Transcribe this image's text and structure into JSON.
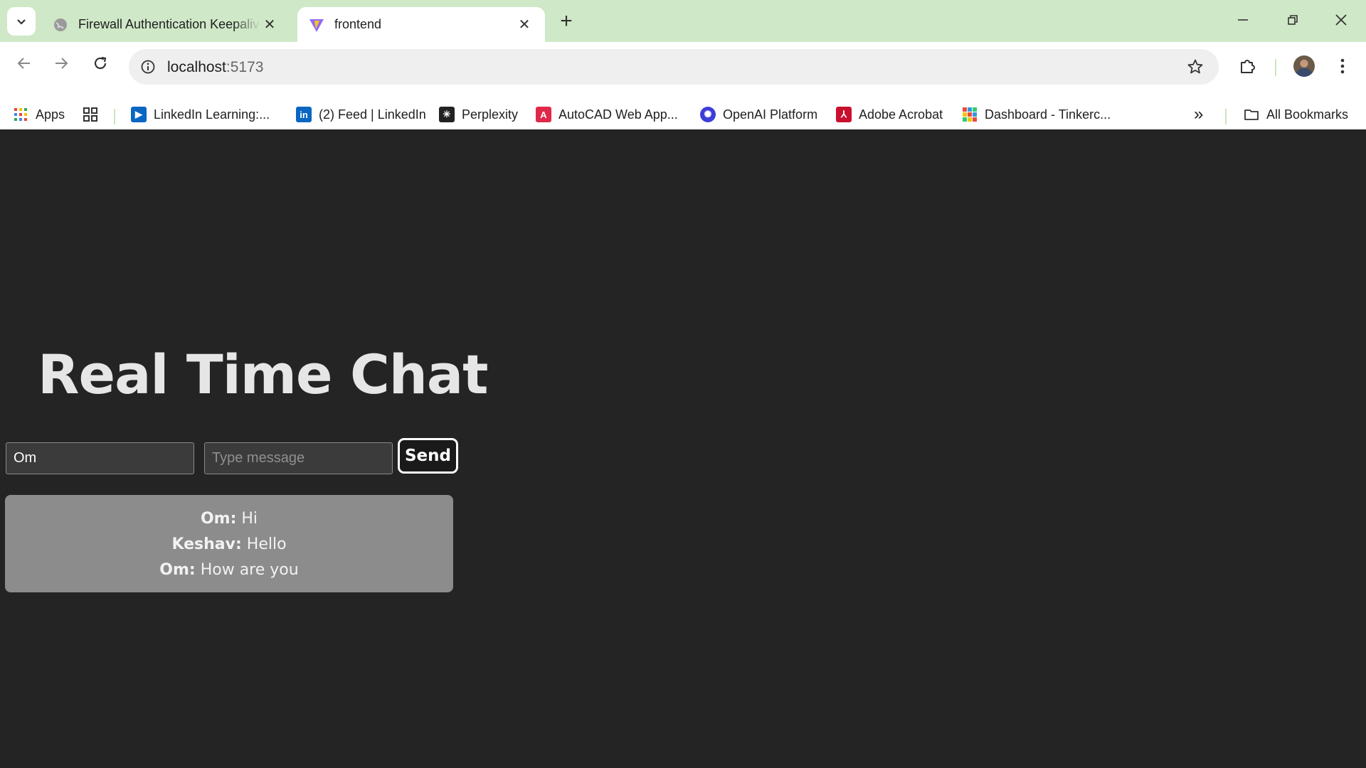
{
  "browser": {
    "tabs": [
      {
        "title": "Firewall Authentication Keepalive",
        "active": false
      },
      {
        "title": "frontend",
        "active": true
      }
    ],
    "new_tab_label": "+",
    "address": {
      "host": "localhost",
      "port": ":5173"
    },
    "bookmarks": [
      {
        "label": "Apps",
        "icon": "apps-grid-icon"
      },
      {
        "label": "LinkedIn Learning:...",
        "icon": "linkedin-learning-icon"
      },
      {
        "label": "(2) Feed | LinkedIn",
        "icon": "linkedin-icon"
      },
      {
        "label": "Perplexity",
        "icon": "perplexity-icon"
      },
      {
        "label": "AutoCAD Web App...",
        "icon": "autocad-icon"
      },
      {
        "label": "OpenAI Platform",
        "icon": "openai-icon"
      },
      {
        "label": "Adobe Acrobat",
        "icon": "adobe-acrobat-icon"
      },
      {
        "label": "Dashboard - Tinkerc...",
        "icon": "tinkercad-icon"
      }
    ],
    "all_bookmarks_label": "All Bookmarks",
    "overflow_label": "»"
  },
  "app": {
    "heading": "Real Time Chat",
    "name_input": {
      "value": "Om",
      "placeholder": ""
    },
    "message_input": {
      "value": "",
      "placeholder": "Type message"
    },
    "send_label": "Send",
    "messages": [
      {
        "sender": "Om:",
        "text": " Hi"
      },
      {
        "sender": "Keshav:",
        "text": " Hello"
      },
      {
        "sender": "Om:",
        "text": " How are you"
      }
    ]
  },
  "colors": {
    "page_background": "#242424",
    "tabstrip_background": "#cfe8c7",
    "chat_box": "#8c8c8c"
  }
}
